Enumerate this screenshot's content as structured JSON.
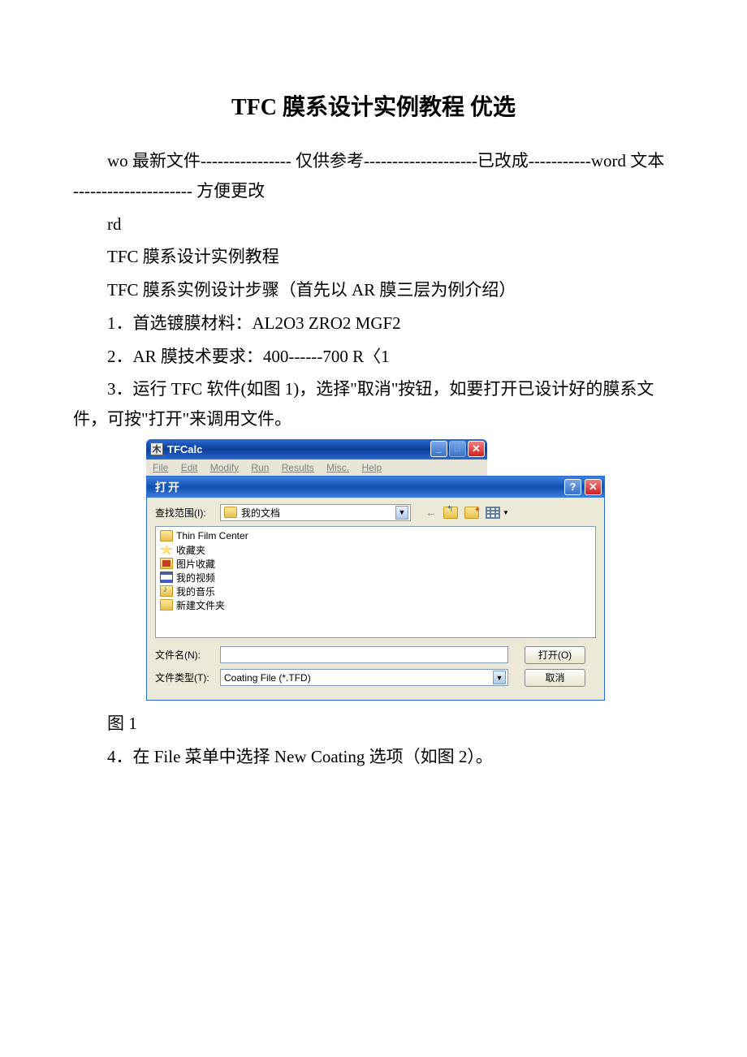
{
  "doc": {
    "title": "TFC 膜系设计实例教程 优选",
    "p1": "wo 最新文件---------------- 仅供参考--------------------已改成-----------word 文本 --------------------- 方便更改",
    "p2": "rd",
    "p3": "TFC 膜系设计实例教程",
    "p4": "TFC 膜系实例设计步骤（首先以 AR 膜三层为例介绍）",
    "p5": "1．首选镀膜材料：AL2O3 ZRO2 MGF2",
    "p6": "2．AR 膜技术要求：400------700 R〈1",
    "p7": "3．运行 TFC 软件(如图 1)，选择\"取消\"按钮，如要打开已设计好的膜系文件，可按\"打开\"来调用文件。",
    "p8": "图 1",
    "p9": "4．在 File 菜单中选择 New Coating 选项（如图 2）。"
  },
  "tfc": {
    "title": "TFCalc",
    "menu": {
      "file": "File",
      "edit": "Edit",
      "modify": "Modify",
      "run": "Run",
      "results": "Results",
      "misc": "Misc.",
      "help": "Help"
    }
  },
  "dialog": {
    "title": "打开",
    "lookin_label": "查找范围(I):",
    "lookin_value": "我的文档",
    "files": {
      "f0": "Thin Film Center",
      "f1": "收藏夹",
      "f2": "图片收藏",
      "f3": "我的视频",
      "f4": "我的音乐",
      "f5": "新建文件夹"
    },
    "filename_label": "文件名(N):",
    "filename_value": "",
    "filetype_label": "文件类型(T):",
    "filetype_value": "Coating File (*.TFD)",
    "open_btn": "打开(O)",
    "cancel_btn": "取消"
  }
}
